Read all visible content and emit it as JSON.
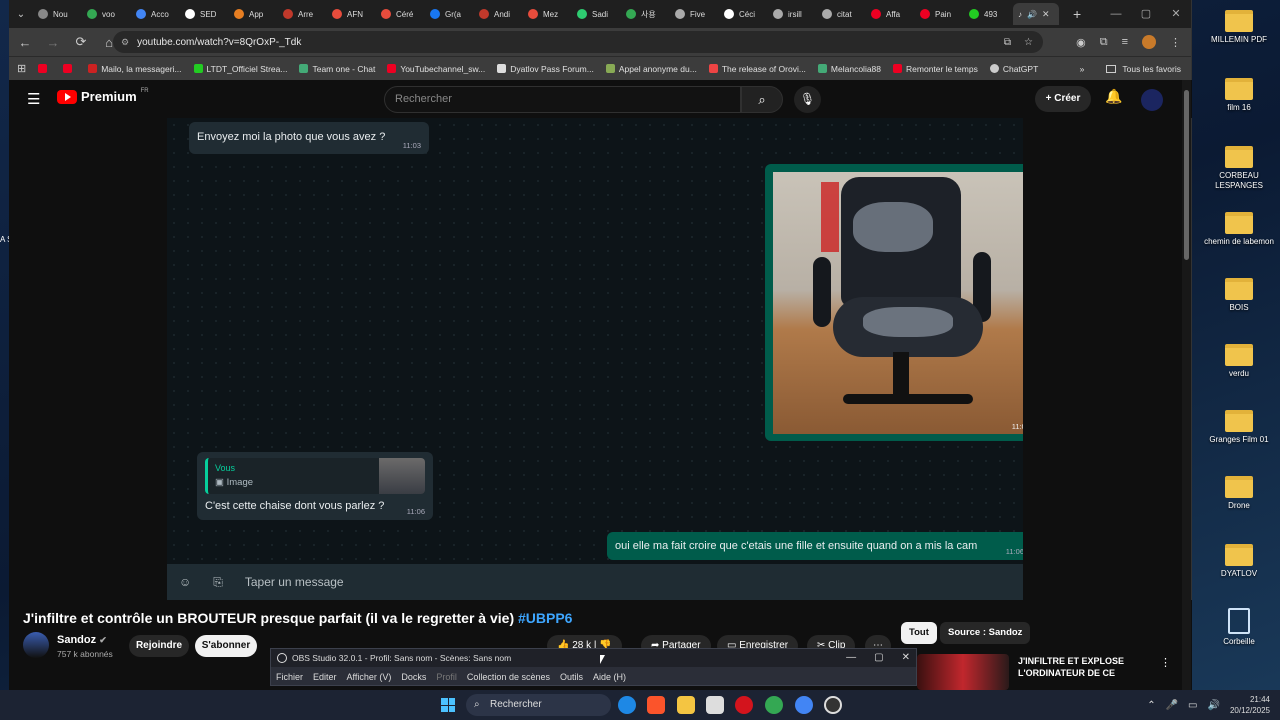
{
  "browser": {
    "tabs": [
      "Nou",
      "voo",
      "Acco",
      "SED",
      "App",
      "Arre",
      "AFN",
      "Céré",
      "Gr(a",
      "Andi",
      "Mez",
      "Sadi",
      "사용",
      "Five",
      "Céci",
      "irsill",
      "citat",
      "Affa",
      "Pain",
      "493"
    ],
    "active_tab_index": 20,
    "url": "youtube.com/watch?v=8QrOxP-_Tdk",
    "bookmarks": [
      "",
      "",
      "Mailo, la messageri...",
      "LTDT_Officiel Strea...",
      "Team one - Chat",
      "YouTubechannel_sw...",
      "Dyatlov Pass Forum...",
      "Appel anonyme du...",
      "The release of Orovi...",
      "Melancolia88",
      "Remonter le temps",
      "ChatGPT"
    ],
    "bookmarks_all": "Tous les favoris"
  },
  "youtube": {
    "logo": "Premium",
    "logo_region": "FR",
    "search_placeholder": "Rechercher",
    "create_label": "Créer"
  },
  "chat": {
    "msg1": {
      "text": "Envoyez moi la photo que vous avez ?",
      "time": "11:03"
    },
    "image_msg": {
      "time": "11:04"
    },
    "reply": {
      "name": "Vous",
      "type": "Image",
      "text": "C'est cette chaise dont vous parlez ?",
      "time": "11:06"
    },
    "msg_out": {
      "text": "oui elle ma fait croire que c'etais une fille et ensuite quand on a mis la cam",
      "time": "11:06"
    },
    "composer_placeholder": "Taper un message"
  },
  "video": {
    "title": "J'infiltre et contrôle un BROUTEUR presque parfait (il va le regretter à vie)",
    "hashtag": "#UBPP6",
    "channel": "Sandoz",
    "subscribers": "757 k abonnés",
    "join": "Rejoindre",
    "subscribe": "S'abonner",
    "likes": "28 k",
    "share": "Partager",
    "save": "Enregistrer",
    "clip": "Clip",
    "chip_all": "Tout",
    "chip_source": "Source : Sandoz",
    "recommended_title": "J'INFILTRE ET EXPLOSE L'ORDINATEUR DE CE"
  },
  "obs": {
    "title": "OBS Studio 32.0.1 - Profil: Sans nom - Scènes: Sans nom",
    "menu": [
      "Fichier",
      "Editer",
      "Afficher (V)",
      "Docks",
      "Profil",
      "Collection de scènes",
      "Outils",
      "Aide (H)"
    ]
  },
  "desktop": {
    "icons": [
      "MILLEMIN PDF",
      "film 16",
      "CORBEAU LESPANGES",
      "chemin de labemon",
      "BOIS",
      "verdu",
      "Granges Film 01",
      "Drone",
      "DYATLOV",
      "Corbeille"
    ],
    "left_text": "A S"
  },
  "taskbar": {
    "search": "Rechercher",
    "time": "21:44",
    "date": "20/12/2025"
  }
}
